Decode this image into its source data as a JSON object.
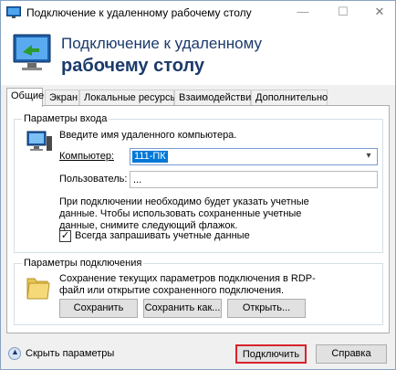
{
  "window": {
    "title": "Подключение к удаленному рабочему столу",
    "icon": "remote-desktop-icon"
  },
  "banner": {
    "line1": "Подключение к удаленному",
    "line2": "рабочему столу"
  },
  "tabs": [
    {
      "label": "Общие",
      "active": true
    },
    {
      "label": "Экран",
      "active": false
    },
    {
      "label": "Локальные ресурсы",
      "active": false
    },
    {
      "label": "Взаимодействие",
      "active": false
    },
    {
      "label": "Дополнительно",
      "active": false
    }
  ],
  "login": {
    "legend": "Параметры входа",
    "prompt": "Введите имя удаленного компьютера.",
    "computer_label": "Компьютер:",
    "computer_value": "111-ПК",
    "user_label": "Пользователь:",
    "user_value": "...",
    "info": "При подключении необходимо будет указать учетные данные. Чтобы использовать сохраненные учетные данные, снимите следующий флажок.",
    "always_ask_label": "Всегда запрашивать учетные данные",
    "always_ask_checked": true
  },
  "connection": {
    "legend": "Параметры подключения",
    "info": "Сохранение текущих параметров подключения в RDP-файл или открытие сохраненного подключения.",
    "save": "Сохранить",
    "save_as": "Сохранить как...",
    "open": "Открыть..."
  },
  "footer": {
    "hide_options": "Скрыть параметры",
    "connect": "Подключить",
    "help": "Справка"
  },
  "colors": {
    "accent": "#1b3a6b",
    "selection": "#0078d7",
    "highlight_border": "#d9232a"
  }
}
